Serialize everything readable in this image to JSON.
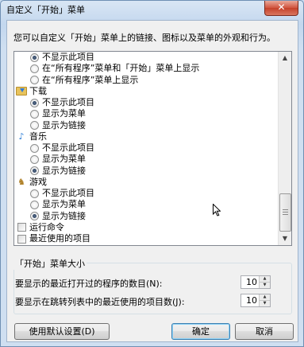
{
  "window": {
    "title": "自定义「开始」菜单",
    "close_label": "✕"
  },
  "intro": "您可以自定义「开始」菜单上的链接、图标以及菜单的外观和行为。",
  "list": {
    "rows": [
      {
        "kind": "radio",
        "label": "不显示此项目",
        "checked": true
      },
      {
        "kind": "radio",
        "label": "在“所有程序”菜单和「开始」菜单上显示",
        "checked": false
      },
      {
        "kind": "radio",
        "label": "在“所有程序”菜单上显示",
        "checked": false
      },
      {
        "kind": "category",
        "label": "下载",
        "icon": "downloads-folder-icon"
      },
      {
        "kind": "radio",
        "label": "不显示此项目",
        "checked": true
      },
      {
        "kind": "radio",
        "label": "显示为菜单",
        "checked": false
      },
      {
        "kind": "radio",
        "label": "显示为链接",
        "checked": false
      },
      {
        "kind": "category",
        "label": "音乐",
        "icon": "music-note-icon"
      },
      {
        "kind": "radio",
        "label": "不显示此项目",
        "checked": false
      },
      {
        "kind": "radio",
        "label": "显示为菜单",
        "checked": false
      },
      {
        "kind": "radio",
        "label": "显示为链接",
        "checked": true
      },
      {
        "kind": "category",
        "label": "游戏",
        "icon": "games-icon"
      },
      {
        "kind": "radio",
        "label": "不显示此项目",
        "checked": false
      },
      {
        "kind": "radio",
        "label": "显示为菜单",
        "checked": false
      },
      {
        "kind": "radio",
        "label": "显示为链接",
        "checked": true
      },
      {
        "kind": "checkbox",
        "label": "运行命令",
        "checked": false
      },
      {
        "kind": "checkbox",
        "label": "最近使用的项目",
        "checked": false
      }
    ]
  },
  "menu_size": {
    "legend": "「开始」菜单大小",
    "recent_programs_label": "要显示的最近打开过的程序的数目(N):",
    "recent_programs_value": "10",
    "jump_list_label": "要显示在跳转列表中的最近使用的项目数(J):",
    "jump_list_value": "10"
  },
  "buttons": {
    "defaults": "使用默认设置(D)",
    "ok": "确定",
    "cancel": "取消"
  }
}
